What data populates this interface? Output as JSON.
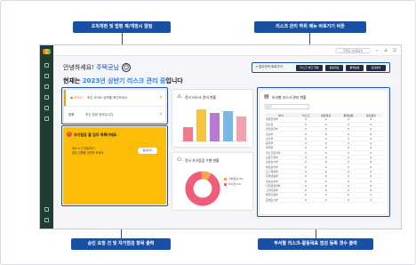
{
  "callouts": {
    "top_left": "조직개편 및 법령 제/개정시 알림",
    "top_right": "리스크 관리 하위 메뉴 바로가기 버튼",
    "bottom_left": "승인 요청 건 및 자가점검 항목 출력",
    "bottom_right": "부서별 리스크-활동목표 점검 등록 갯수 출력"
  },
  "topbar": {
    "user_label": "주택도시보증공사",
    "icons": [
      "minus-icon",
      "home-icon",
      "logout-icon"
    ]
  },
  "greeting": {
    "line1_prefix": "안녕하세요! ",
    "line1_name": "주택공님",
    "smile": "☺",
    "line2_prefix": "현재는 ",
    "line2_highlight": "2023년 상반기 리스크 관리 중",
    "line2_suffix": "입니다"
  },
  "shortcut": {
    "title": "업무관리 바로가기",
    "buttons": [
      "리스크 체크 현황",
      "활동목표",
      "통제활동",
      "점검결과"
    ]
  },
  "notice": {
    "rows": [
      {
        "tag": "● 조직도",
        "text": "최신 조직도 정보를 확인하세요",
        "arrow": "›"
      },
      {
        "tag": "법령",
        "text": "최신 법령 정보입니다",
        "arrow": "›"
      }
    ]
  },
  "yellow": {
    "badge": "!",
    "title": "자가점검 할 업무 목록이에요",
    "sub1": "최소 0 건 완료하기",
    "sub2": "업무 진행을 안전히 하세요",
    "button": "점검하기"
  },
  "bar_card": {
    "title": "전사 리스크 관리 현황",
    "icon": "warning-icon"
  },
  "donut_card": {
    "title": "전사 자가점검 수행 현황",
    "icon": "people-icon",
    "legend": [
      "자체점검 0%",
      "미수행 0%"
    ]
  },
  "dept_card": {
    "title": "부서별 리스크 관리 현황",
    "icon": "clipboard-icon",
    "search_placeholder": "검색",
    "columns": [
      "부서",
      "리스크",
      "활동목표",
      "통제활동",
      "점검결과"
    ],
    "rows": [
      [
        "경영전략부",
        "0",
        "0",
        "0",
        "0"
      ],
      [
        "감사실",
        "0",
        "0",
        "0",
        "0"
      ],
      [
        "안전관리부",
        "0",
        "0",
        "0",
        "0"
      ],
      [
        "홍보부",
        "0",
        "0",
        "0",
        "0"
      ],
      [
        "인사부",
        "0",
        "0",
        "0",
        "0"
      ],
      [
        "총무부",
        "0",
        "0",
        "0",
        "0"
      ],
      [
        "재무부",
        "0",
        "0",
        "0",
        "0"
      ],
      [
        "리스크관리부",
        "0",
        "0",
        "0",
        "0"
      ],
      [
        "보증기획부",
        "0",
        "0",
        "0",
        "0"
      ],
      [
        "보증심사부",
        "0",
        "0",
        "0",
        "0"
      ],
      [
        "채권관리부",
        "0",
        "0",
        "0",
        "0"
      ],
      [
        "도시재생부",
        "0",
        "0",
        "0",
        "0"
      ],
      [
        "주택금융부",
        "0",
        "0",
        "0",
        "0"
      ],
      [
        "정보보호부",
        "0",
        "0",
        "0",
        "0"
      ],
      [
        "디지털전략부",
        "0",
        "0",
        "0",
        "0"
      ],
      [
        "고객지원부",
        "0",
        "0",
        "0",
        "0"
      ],
      [
        "법무지원부",
        "0",
        "0",
        "0",
        "0"
      ],
      [
        "준법감시부",
        "0",
        "0",
        "0",
        "0"
      ]
    ]
  },
  "colors": {
    "accent": "#1a4fa3",
    "sidebar": "#1f3d33",
    "yellow": "#fbbd08",
    "donut_main": "#f25c7a",
    "donut_light": "#f8a64a"
  },
  "chart_data": {
    "type": "bar",
    "categories": [
      "A",
      "B",
      "C",
      "D",
      "E"
    ],
    "series": [
      {
        "values": [
          40,
          90,
          80,
          85,
          70
        ]
      }
    ],
    "colors": [
      "#f27a8a",
      "#f5c342",
      "#b779d4",
      "#7bb6e8",
      "#f5a0b0"
    ],
    "ylim": [
      0,
      100
    ]
  }
}
